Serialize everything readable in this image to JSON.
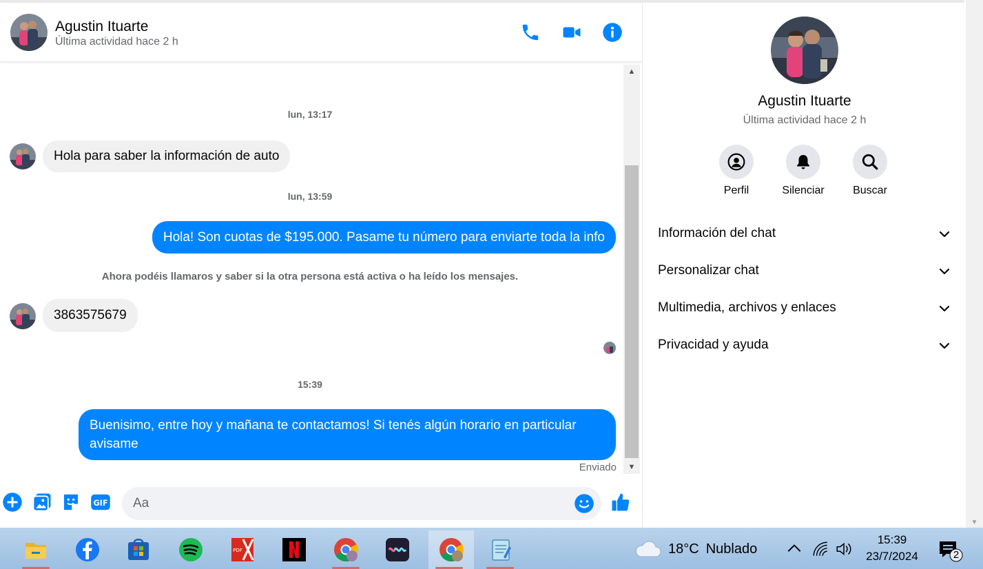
{
  "colors": {
    "accent": "#0084ff",
    "bubble_in": "#f0f0f0",
    "muted": "#65676b"
  },
  "header": {
    "name": "Agustin Ituarte",
    "status": "Última actividad hace 2 h",
    "icons": [
      "phone-icon",
      "video-icon",
      "info-icon"
    ]
  },
  "messages": {
    "ts1": "lun, 13:17",
    "m1": "Hola para saber la información de auto",
    "ts2": "lun, 13:59",
    "m2": "Hola! Son cuotas de $195.000. Pasame tu número para enviarte toda la info",
    "notice": "Ahora podéis llamaros y saber si la otra persona está activa o ha leído los mensajes.",
    "m3": "3863575679",
    "ts3": "15:39",
    "m4_line1": "Buenisimo, entre hoy y mañana te contactamos! Si tenés algún horario en particular",
    "m4_line2": "avisame",
    "sent": "Enviado"
  },
  "composer": {
    "placeholder": "Aa",
    "icons": [
      "plus-icon",
      "image-icon",
      "sticker-icon",
      "gif-icon",
      "emoji-icon",
      "like-icon"
    ]
  },
  "info": {
    "name": "Agustin Ituarte",
    "status": "Última actividad hace 2 h",
    "actions": [
      {
        "label": "Perfil",
        "icon": "profile-icon"
      },
      {
        "label": "Silenciar",
        "icon": "bell-icon"
      },
      {
        "label": "Buscar",
        "icon": "search-icon"
      }
    ],
    "sections": [
      {
        "label": "Información del chat"
      },
      {
        "label": "Personalizar chat"
      },
      {
        "label": "Multimedia, archivos y enlaces"
      },
      {
        "label": "Privacidad y ayuda"
      }
    ]
  },
  "taskbar": {
    "apps": [
      "file-explorer-icon",
      "facebook-icon",
      "microsoft-store-icon",
      "spotify-icon",
      "pdf-icon",
      "netflix-icon",
      "chrome-icon",
      "wave-app-icon",
      "chrome-icon",
      "notepad-icon"
    ],
    "weather": {
      "temp": "18°C",
      "desc": "Nublado"
    },
    "time": "15:39",
    "date": "23/7/2024",
    "notifications": "2"
  }
}
